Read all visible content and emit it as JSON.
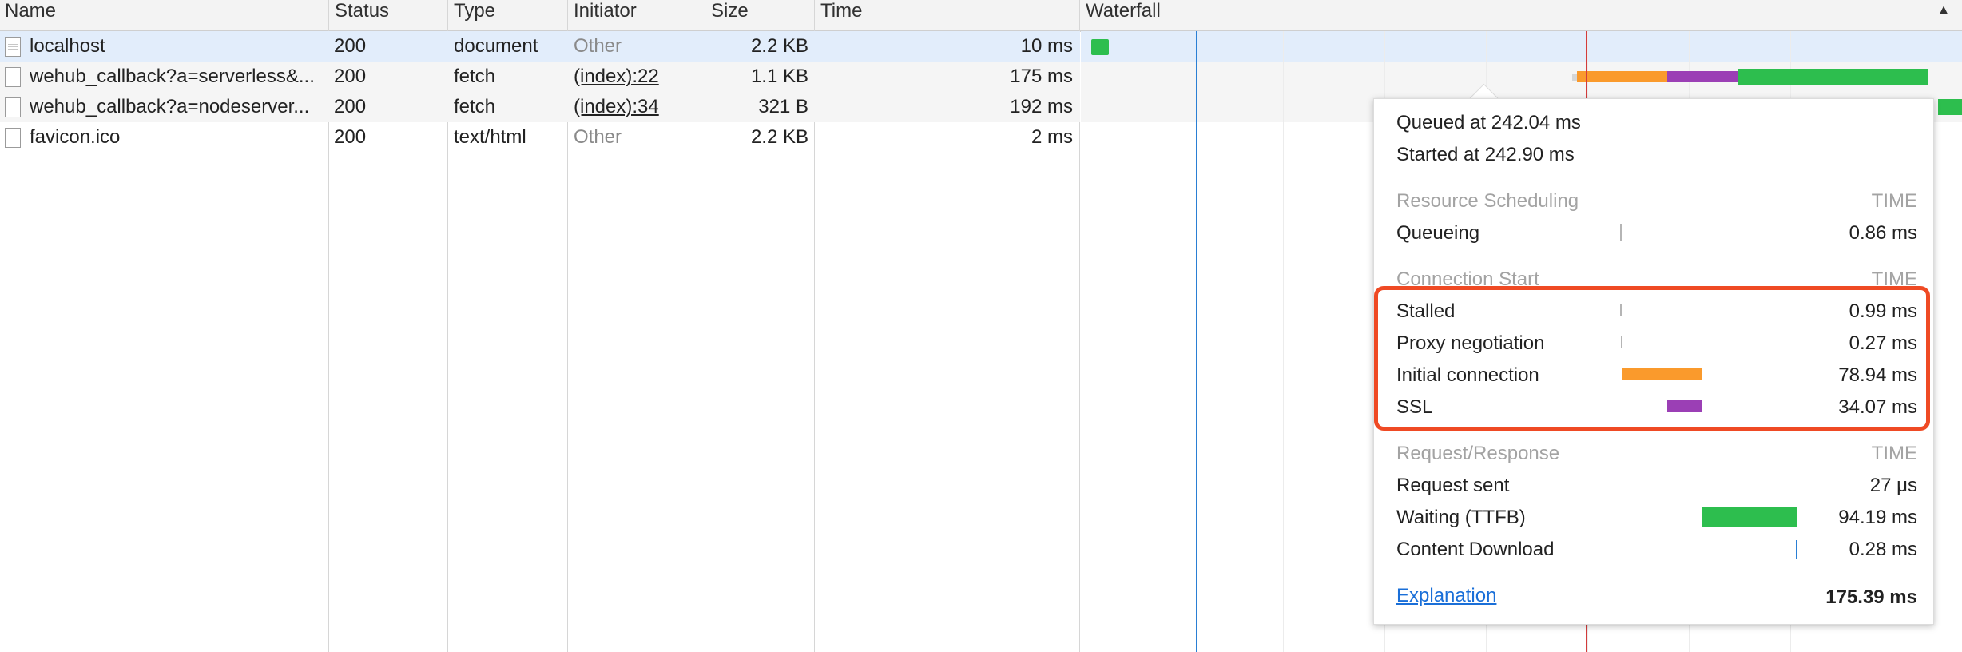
{
  "columns": {
    "name": "Name",
    "status": "Status",
    "type": "Type",
    "initiator": "Initiator",
    "size": "Size",
    "time": "Time",
    "waterfall": "Waterfall"
  },
  "sort_indicator": "▲",
  "rows": [
    {
      "name": "localhost",
      "status": "200",
      "type": "document",
      "initiator": "Other",
      "size": "2.2 KB",
      "time": "10 ms",
      "icon": "document-icon"
    },
    {
      "name": "wehub_callback?a=serverless&...",
      "status": "200",
      "type": "fetch",
      "initiator": "(index):22",
      "size": "1.1 KB",
      "time": "175 ms",
      "icon": "file-icon"
    },
    {
      "name": "wehub_callback?a=nodeserver...",
      "status": "200",
      "type": "fetch",
      "initiator": "(index):34",
      "size": "321 B",
      "time": "192 ms",
      "icon": "file-icon"
    },
    {
      "name": "favicon.ico",
      "status": "200",
      "type": "text/html",
      "initiator": "Other",
      "size": "2.2 KB",
      "time": "2 ms",
      "icon": "file-icon"
    }
  ],
  "timing_popup": {
    "queued_at": "Queued at 242.04 ms",
    "started_at": "Started at 242.90 ms",
    "section_scheduling": {
      "label": "Resource Scheduling",
      "time_label": "TIME"
    },
    "queueing": {
      "label": "Queueing",
      "value": "0.86 ms"
    },
    "section_connection": {
      "label": "Connection Start",
      "time_label": "TIME"
    },
    "stalled": {
      "label": "Stalled",
      "value": "0.99 ms"
    },
    "proxy": {
      "label": "Proxy negotiation",
      "value": "0.27 ms"
    },
    "initial_connection": {
      "label": "Initial connection",
      "value": "78.94 ms"
    },
    "ssl": {
      "label": "SSL",
      "value": "34.07 ms"
    },
    "section_request": {
      "label": "Request/Response",
      "time_label": "TIME"
    },
    "request_sent": {
      "label": "Request sent",
      "value": "27 μs"
    },
    "waiting": {
      "label": "Waiting (TTFB)",
      "value": "94.19 ms"
    },
    "content_download": {
      "label": "Content Download",
      "value": "0.28 ms"
    },
    "explanation": "Explanation",
    "total": "175.39 ms"
  },
  "colors": {
    "connection": "#fa9a2c",
    "ssl": "#9b3fb5",
    "waiting": "#2dbe4e",
    "download": "#2a7fd4",
    "highlight": "#ef4a24",
    "selected_row": "#e2edfb",
    "alt_row": "#f5f5f5"
  }
}
